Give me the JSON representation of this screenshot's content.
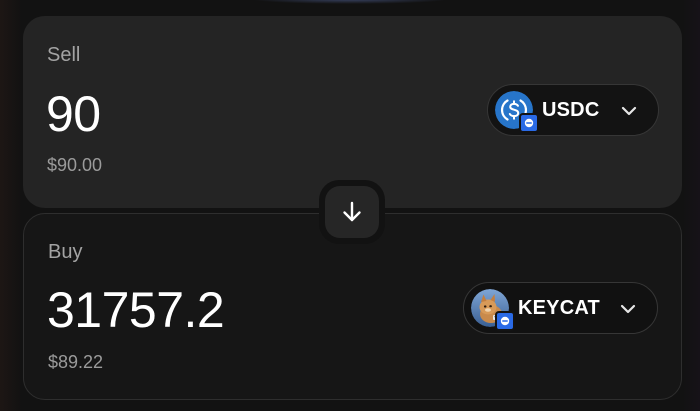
{
  "sell": {
    "label": "Sell",
    "amount": "90",
    "usd_value": "$90.00",
    "token": {
      "symbol": "USDC",
      "icon": "usdc-logo-icon",
      "chain_badge_icon": "chain-badge-icon"
    }
  },
  "swap_button": {
    "icon": "arrow-down-icon"
  },
  "buy": {
    "label": "Buy",
    "amount": "31757.2",
    "usd_value": "$89.22",
    "token": {
      "symbol": "KEYCAT",
      "icon": "keycat-logo-icon",
      "chain_badge_icon": "chain-badge-icon"
    }
  },
  "colors": {
    "sell_panel": "#242424",
    "buy_panel": "#161616",
    "usdc_blue": "#2775ca",
    "chain_badge": "#2a6ae6",
    "muted_text": "#9b9b9b"
  }
}
